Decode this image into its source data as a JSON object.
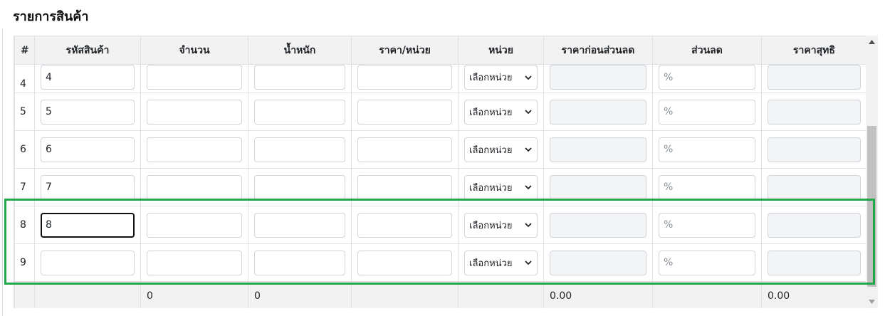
{
  "section": {
    "title": "รายการสินค้า"
  },
  "columns": [
    "#",
    "รหัสสินค้า",
    "จำนวน",
    "น้ำหนัก",
    "ราคา/หน่วย",
    "หน่วย",
    "ราคาก่อนส่วนลด",
    "ส่วนลด",
    "ราคาสุทธิ"
  ],
  "rows": [
    {
      "num": "4",
      "code": "4"
    },
    {
      "num": "5",
      "code": "5"
    },
    {
      "num": "6",
      "code": "6"
    },
    {
      "num": "7",
      "code": "7"
    },
    {
      "num": "8",
      "code": "8"
    },
    {
      "num": "9",
      "code": ""
    }
  ],
  "unit_select": {
    "selected": "เลือกหน่วย"
  },
  "discount_placeholder": "%",
  "totals": {
    "quantity": "0",
    "weight": "0",
    "price_before_discount": "0.00",
    "net_price": "0.00"
  },
  "colors": {
    "highlight": "#22a74a",
    "focus_border": "#111111"
  },
  "icons": {
    "select": "chevron-down-icon",
    "scroll_up": "arrow-up-icon",
    "scroll_down": "arrow-down-icon"
  }
}
